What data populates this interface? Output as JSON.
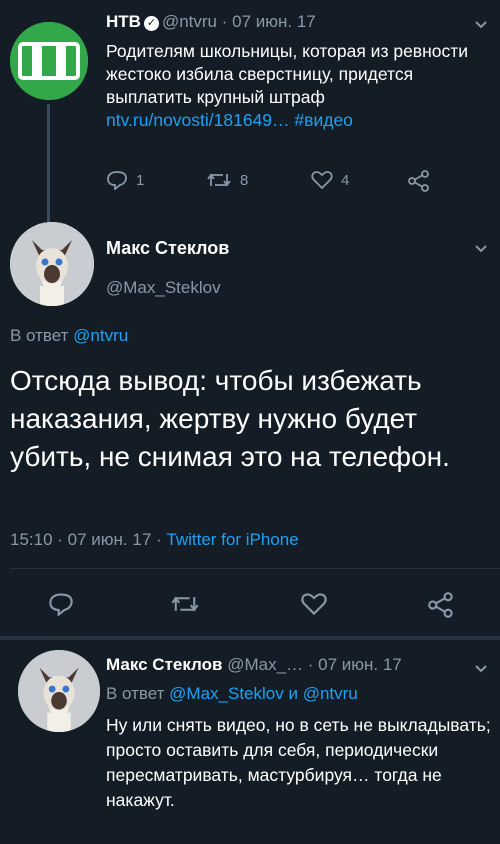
{
  "tweet1": {
    "name": "НТВ",
    "handle_time": "@ntvru · 07 июн. 17",
    "text": "Родителям школьницы, которая из ревности жестоко избила сверстницу, придется выплатить крупный штраф",
    "link": "ntv.ru/novosti/181649…",
    "hashtag": "#видео",
    "replies": "1",
    "retweets": "8",
    "likes": "4",
    "logo_text": "НТВ",
    "logo_color": "#33a84a"
  },
  "tweet2": {
    "name": "Макс Стеклов",
    "handle": "@Max_Steklov",
    "reply_prefix": "В ответ ",
    "reply_to": "@ntvru",
    "body": "Отсюда вывод: чтобы избежать наказания, жертву нужно будет убить, не снимая это на телефон.",
    "timestamp": "15:10 · 07 июн. 17 · ",
    "client": "Twitter for iPhone"
  },
  "tweet3": {
    "name": "Макс Стеклов",
    "handle_time": " @Max_… · 07 июн. 17",
    "reply_prefix": "В ответ ",
    "reply_to": "@Max_Steklov и @ntvru",
    "text": "Ну или снять видео, но в сеть не выкладывать; просто оставить для себя, периодически пересматривать, мастурбируя… тогда не накажут."
  },
  "colors": {
    "background": "#141d26",
    "accent": "#1da1f2",
    "muted": "#8899a6"
  },
  "icons": [
    "verified-badge-icon",
    "chevron-down-icon",
    "reply-icon",
    "retweet-icon",
    "like-icon",
    "share-icon"
  ]
}
